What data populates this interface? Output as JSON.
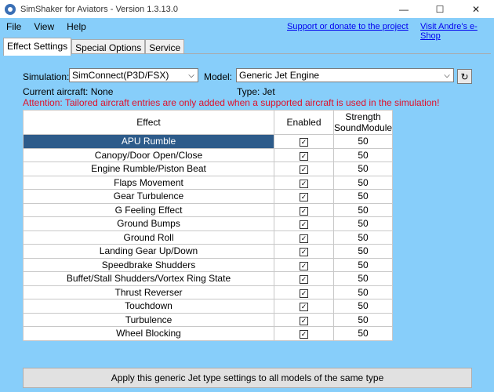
{
  "window": {
    "title": "SimShaker for Aviators  - Version 1.3.13.0",
    "minimize": "—",
    "maximize": "☐",
    "close": "✕"
  },
  "menu": {
    "items": [
      "File",
      "View",
      "Help"
    ],
    "links": [
      "Support or donate to the project",
      "Visit Andre's e-Shop"
    ]
  },
  "tabs": [
    "Effect Settings",
    "Special Options",
    "Service"
  ],
  "form": {
    "simulation_label": "Simulation:",
    "simulation_value": "SimConnect(P3D/FSX)",
    "model_label": "Model:",
    "model_value": "Generic Jet Engine",
    "current_aircraft": "Current aircraft: None",
    "type": "Type: Jet",
    "attention": "Attention: Tailored aircraft entries are only added when a supported aircraft is used in the simulation!"
  },
  "table": {
    "headers": {
      "effect": "Effect",
      "enabled": "Enabled",
      "strength_line1": "Strength",
      "strength_line2": "SoundModule"
    },
    "rows": [
      {
        "effect": "APU Rumble",
        "strength": "50"
      },
      {
        "effect": "Canopy/Door Open/Close",
        "strength": "50"
      },
      {
        "effect": "Engine Rumble/Piston Beat",
        "strength": "50"
      },
      {
        "effect": "Flaps Movement",
        "strength": "50"
      },
      {
        "effect": "Gear Turbulence",
        "strength": "50"
      },
      {
        "effect": "G Feeling Effect",
        "strength": "50"
      },
      {
        "effect": "Ground Bumps",
        "strength": "50"
      },
      {
        "effect": "Ground Roll",
        "strength": "50"
      },
      {
        "effect": "Landing Gear Up/Down",
        "strength": "50"
      },
      {
        "effect": "Speedbrake Shudders",
        "strength": "50"
      },
      {
        "effect": "Buffet/Stall Shudders/Vortex Ring State",
        "strength": "50"
      },
      {
        "effect": "Thrust Reverser",
        "strength": "50"
      },
      {
        "effect": "Touchdown",
        "strength": "50"
      },
      {
        "effect": "Turbulence",
        "strength": "50"
      },
      {
        "effect": "Wheel Blocking",
        "strength": "50"
      }
    ]
  },
  "apply_button": "Apply this generic Jet type settings to all models of the same type",
  "colors": {
    "background": "#87CEFA",
    "selection": "#2D5B8A",
    "attention": "#E0102A",
    "link": "#0000EE"
  }
}
